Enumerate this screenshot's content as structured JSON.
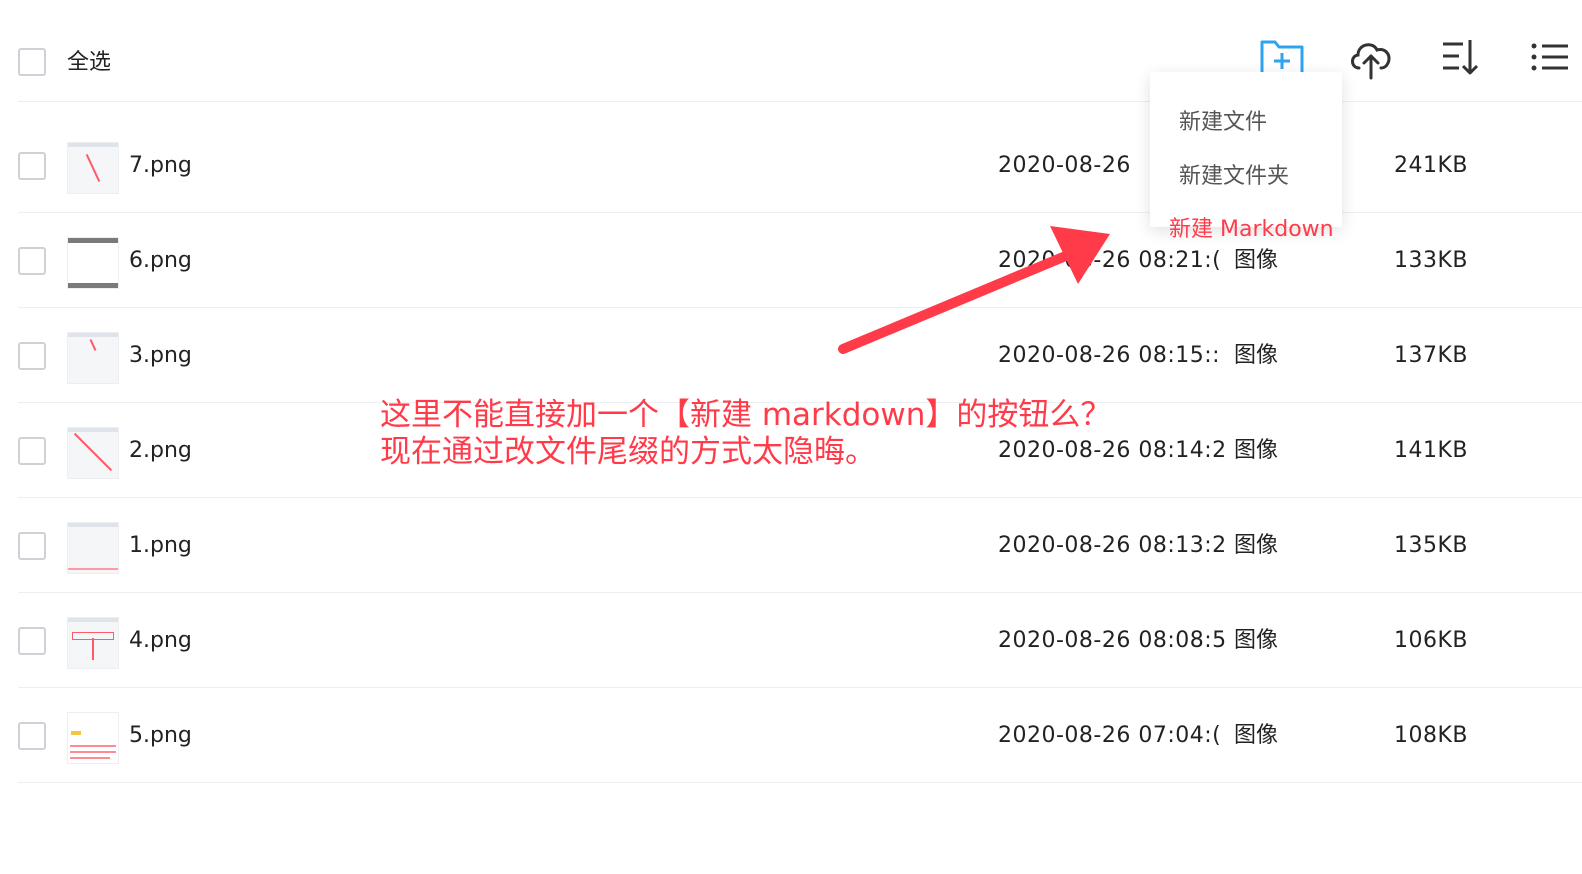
{
  "header": {
    "select_all_label": "全选",
    "toolbar": [
      {
        "icon": "new-folder-icon",
        "color": "#2ea3f2"
      },
      {
        "icon": "cloud-upload-icon",
        "color": "#333333"
      },
      {
        "icon": "sort-icon",
        "color": "#333333"
      },
      {
        "icon": "list-view-icon",
        "color": "#333333"
      }
    ]
  },
  "files": [
    {
      "name": "7.png",
      "date": "2020-08-26",
      "type": "",
      "size": "241KB"
    },
    {
      "name": "6.png",
      "date": "2020-08-26 08:21:(",
      "type": "图像",
      "size": "133KB"
    },
    {
      "name": "3.png",
      "date": "2020-08-26 08:15::",
      "type": "图像",
      "size": "137KB"
    },
    {
      "name": "2.png",
      "date": "2020-08-26 08:14:2",
      "type": "图像",
      "size": "141KB"
    },
    {
      "name": "1.png",
      "date": "2020-08-26 08:13:2",
      "type": "图像",
      "size": "135KB"
    },
    {
      "name": "4.png",
      "date": "2020-08-26 08:08:5",
      "type": "图像",
      "size": "106KB"
    },
    {
      "name": "5.png",
      "date": "2020-08-26 07:04:(",
      "type": "图像",
      "size": "108KB"
    }
  ],
  "menu": {
    "items": [
      "新建文件",
      "新建文件夹",
      "新建 Markdown"
    ]
  },
  "annotation": {
    "line1": "这里不能直接加一个【新建 markdown】的按钮么？",
    "line2": "现在通过改文件尾缀的方式太隐晦。",
    "color": "#ff3b4a"
  }
}
